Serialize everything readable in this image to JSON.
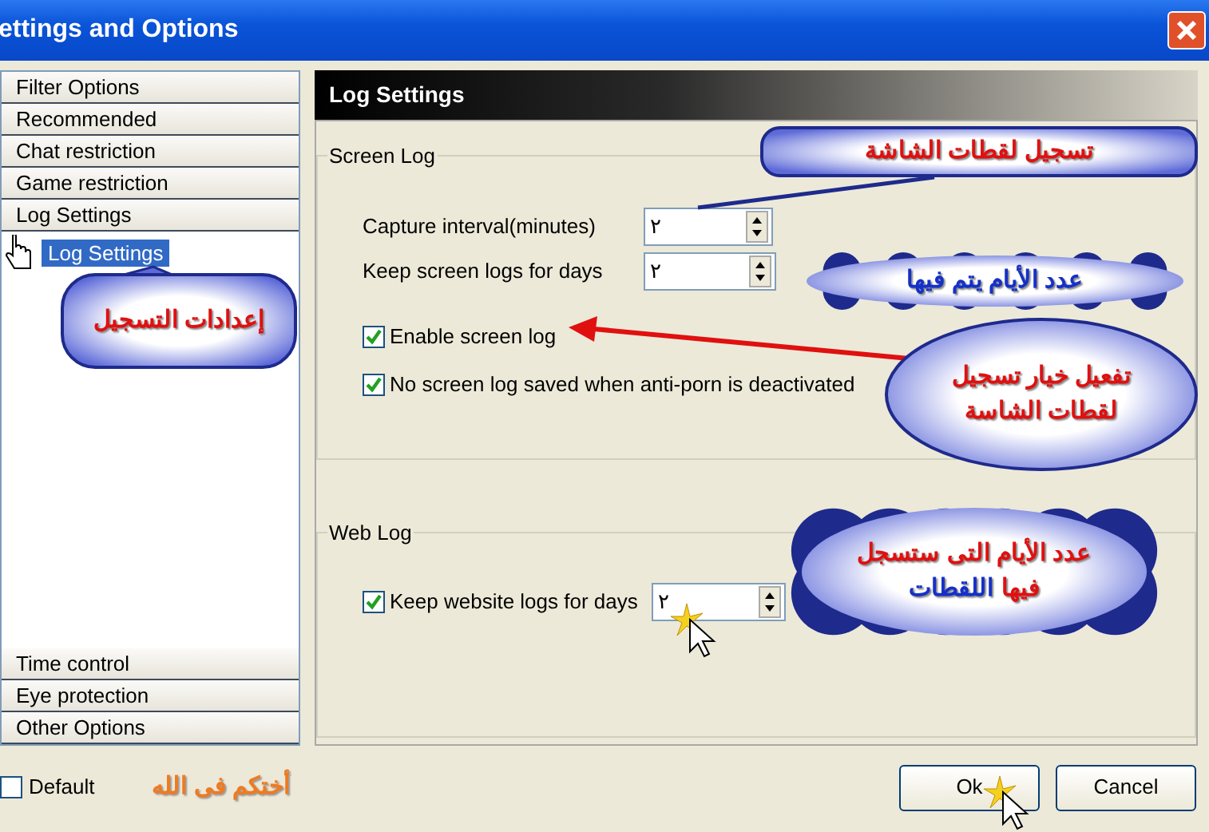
{
  "window": {
    "title": "ettings and Options"
  },
  "nav": {
    "items": [
      {
        "label": "Filter Options"
      },
      {
        "label": "Recommended"
      },
      {
        "label": "Chat restriction"
      },
      {
        "label": "Game restriction"
      },
      {
        "label": "Log Settings",
        "children": [
          {
            "label": "Log Settings",
            "selected": true
          }
        ]
      },
      {
        "label": "Time control"
      },
      {
        "label": "Eye protection"
      },
      {
        "label": "Other Options"
      }
    ]
  },
  "panel": {
    "title": "Log Settings",
    "groups": [
      {
        "title": "Screen Log",
        "rows": [
          {
            "kind": "spin",
            "label": "Capture interval(minutes)",
            "value": "٢"
          },
          {
            "kind": "spin",
            "label": "Keep screen logs for days",
            "value": "٢"
          },
          {
            "kind": "checkbox",
            "label": "Enable screen log",
            "checked": true
          },
          {
            "kind": "checkbox",
            "label": "No screen log saved when anti-porn is deactivated",
            "checked": true
          }
        ]
      },
      {
        "title": "Web Log",
        "rows": [
          {
            "kind": "checkspin",
            "label": "Keep website logs for days",
            "checked": true,
            "value": "٢"
          }
        ]
      }
    ]
  },
  "footer": {
    "default": {
      "label": "Default",
      "checked": false
    },
    "signature": "أختكم فى الله",
    "ok_button": "Ok",
    "cancel_button": "Cancel"
  },
  "annotations": [
    {
      "kind": "rounded",
      "lines": [
        [
          {
            "text": "تسجيل لقطات الشاشة",
            "color": "#e01010"
          }
        ]
      ]
    },
    {
      "kind": "cloud",
      "lines": [
        [
          {
            "text": "عدد الأيام يتم فيها",
            "color": "#1530c8"
          }
        ]
      ]
    },
    {
      "kind": "ellipse",
      "lines": [
        [
          {
            "text": "تفعيل خيار تسجيل",
            "color": "#e01010"
          }
        ],
        [
          {
            "text": "لقطات الشاسة",
            "color": "#e01010"
          }
        ]
      ]
    },
    {
      "kind": "rounded",
      "lines": [
        [
          {
            "text": "إعدادات التسجيل",
            "color": "#e01010"
          }
        ]
      ]
    },
    {
      "kind": "cloud",
      "lines": [
        [
          {
            "text": "عدد الأيام التى ستسجل",
            "color": "#e01010"
          }
        ],
        [
          {
            "text": "فيها",
            "color": "#e01010"
          },
          {
            "text": "اللقطات",
            "color": "#1530c8"
          }
        ]
      ]
    }
  ]
}
